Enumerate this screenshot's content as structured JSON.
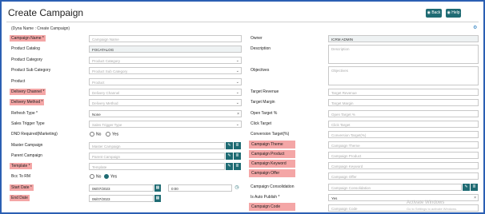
{
  "page": {
    "title": "Create Campaign",
    "subtitle": "(Dyna Name : Create Campaign)"
  },
  "toolbar": {
    "back_label": "◉ Back",
    "help_label": "◉ Help"
  },
  "left": {
    "campaign_name": {
      "label": "Campaign Name *",
      "placeholder": "Campaign Name"
    },
    "product_catalog": {
      "label": "Product Catalog",
      "value": "FOCATALOG"
    },
    "product_category": {
      "label": "Product Category",
      "placeholder": "Product Category"
    },
    "product_sub_category": {
      "label": "Product Sub Category",
      "placeholder": "Product Sub Category"
    },
    "product": {
      "label": "Product",
      "placeholder": "Product"
    },
    "delivery_channel": {
      "label": "Delivery Channel *",
      "placeholder": "Delivery Channel"
    },
    "delivery_method": {
      "label": "Delivery Method *",
      "placeholder": "Delivery Method"
    },
    "refresh_type": {
      "label": "Refresh Type *",
      "value": "None"
    },
    "sales_trigger_type": {
      "label": "Sales Trigger Type",
      "placeholder": "Sales Trigger Type"
    },
    "dnd_required": {
      "label": "DND Required(Marketing)",
      "options": [
        "No",
        "Yes"
      ]
    },
    "master_campaign": {
      "label": "Master Campaign",
      "placeholder": "Master Campaign"
    },
    "parent_campaign": {
      "label": "Parent Campaign",
      "placeholder": "Parent Campaign"
    },
    "template": {
      "label": "Template *",
      "placeholder": "Template"
    },
    "bcc_to_rm": {
      "label": "Bcc To RM",
      "options": [
        "No",
        "Yes"
      ]
    },
    "start_date": {
      "label": "Start Date *",
      "value": "06/07/2023",
      "time": "0:00"
    },
    "end_date": {
      "label": "End Date",
      "value": "06/07/2023"
    }
  },
  "right": {
    "owner": {
      "label": "Owner",
      "value": "ICRM ADMIN"
    },
    "description": {
      "label": "Description",
      "placeholder": "Description"
    },
    "objectives": {
      "label": "Objectives",
      "placeholder": "Objectives"
    },
    "target_revenue": {
      "label": "Target Revenue",
      "placeholder": "Target Revenue"
    },
    "target_margin": {
      "label": "Target Margin",
      "placeholder": "Target Margin"
    },
    "open_target": {
      "label": "Open Target %",
      "placeholder": "Open Target %"
    },
    "click_target": {
      "label": "Click Target",
      "placeholder": "Click Target"
    },
    "conversion_target": {
      "label": "Conversion Target(%)",
      "placeholder": "Conversion Target(%)"
    },
    "campaign_theme": {
      "label": "Campaign Theme",
      "placeholder": "Campaign Theme"
    },
    "campaign_product": {
      "label": "Campaign Product",
      "placeholder": "Campaign Product"
    },
    "campaign_keyword": {
      "label": "Campaign Keyword",
      "placeholder": "Campaign Keyword"
    },
    "campaign_offer": {
      "label": "Campaign Offer",
      "placeholder": "Campaign Offer"
    },
    "campaign_consolidation": {
      "label": "Campaign Consolidation",
      "placeholder": "Campaign Consolidation"
    },
    "is_auto_publish": {
      "label": "Is Auto Publish *",
      "value": "Yes"
    },
    "campaign_code": {
      "label": "Campaign Code",
      "placeholder": "Campaign Code"
    }
  },
  "icons": {
    "edit": "✎",
    "list": "≣",
    "calendar": "▦",
    "clock": "◷",
    "clear": "×",
    "dropdown": "⌄",
    "gear": "⚙"
  },
  "watermark": {
    "line1": "Activate Windows",
    "line2": "Go to Settings to activate Windows."
  },
  "colors": {
    "accent": "#1f6b73",
    "highlight": "#f4a6a6",
    "frame": "#2b5fb3"
  }
}
